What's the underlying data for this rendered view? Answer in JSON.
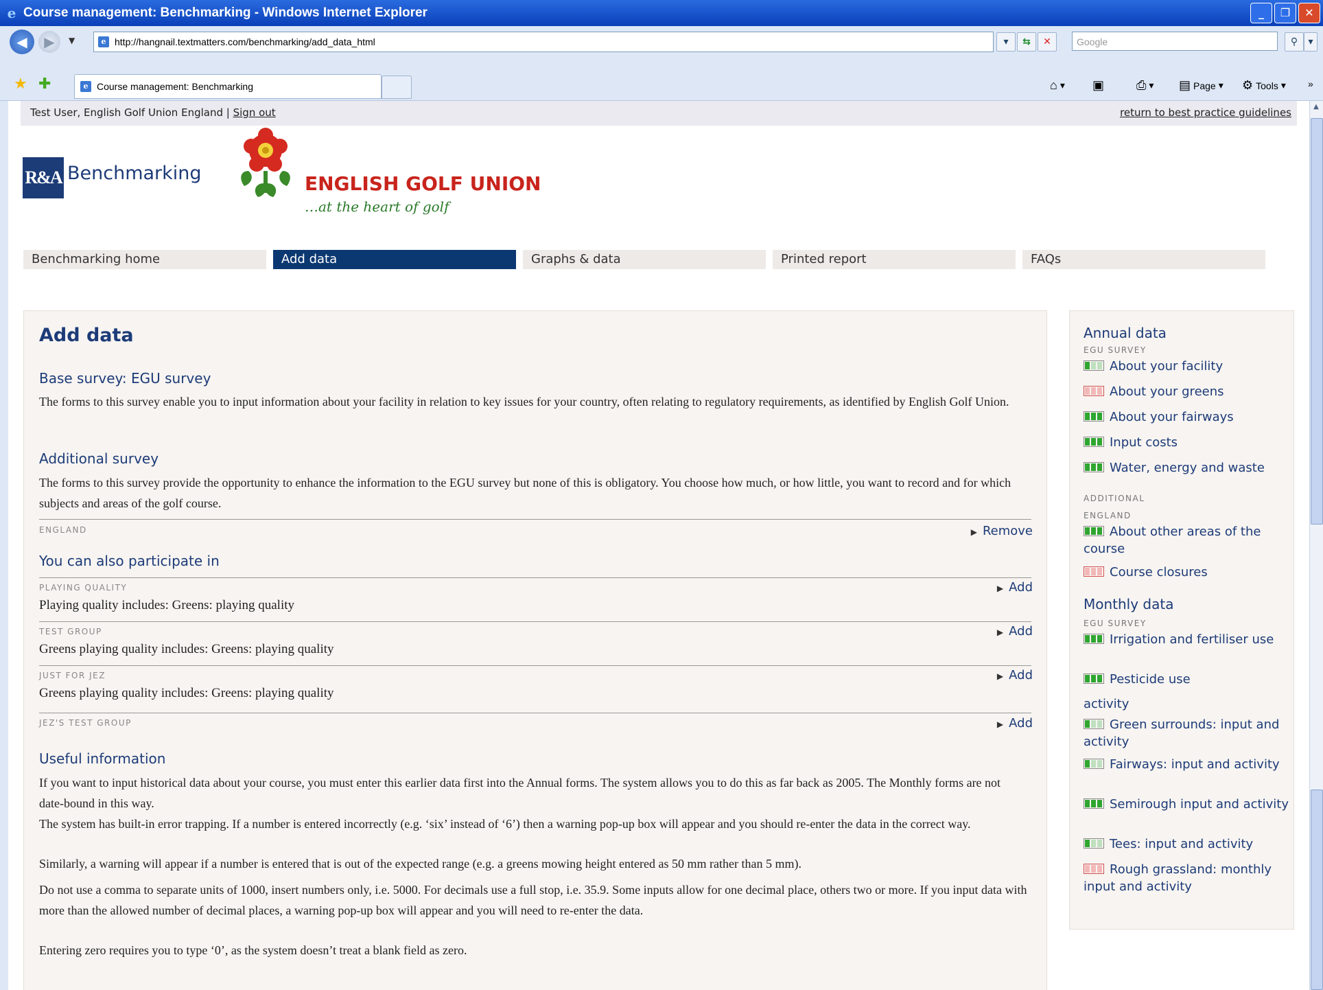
{
  "window": {
    "title": "Course management: Benchmarking - Windows Internet Explorer",
    "url": "http://hangnail.textmatters.com/benchmarking/add_data_html",
    "search_placeholder": "Google",
    "tab_title": "Course management: Benchmarking",
    "commands": {
      "page": "Page",
      "tools": "Tools"
    }
  },
  "userbar": {
    "user": "Test User, English Golf Union England",
    "separator": "|",
    "signout": "Sign out",
    "return_link": "return to best practice guidelines"
  },
  "brand": {
    "ra_logo": "R&A",
    "ra_text": "Benchmarking",
    "egu_name": "ENGLISH GOLF UNION",
    "egu_tagline": "…at the heart of golf"
  },
  "nav": [
    {
      "label": "Benchmarking home",
      "active": false
    },
    {
      "label": "Add data",
      "active": true
    },
    {
      "label": "Graphs & data",
      "active": false
    },
    {
      "label": "Printed report",
      "active": false
    },
    {
      "label": "FAQs",
      "active": false
    }
  ],
  "main": {
    "title": "Add data",
    "base_heading": "Base survey: EGU survey",
    "base_text": "The forms to this survey enable you to input information about your facility in relation to key issues for your country, often relating to regulatory requirements, as identified by English Golf Union.",
    "additional_heading": "Additional survey",
    "additional_text": "The forms to this survey provide the opportunity to enhance the information to the EGU survey but none of this is obligatory. You choose how much, or how little, you want to record and for which subjects and areas of the golf course.",
    "england_label": "ENGLAND",
    "remove_label": "Remove",
    "participate_heading": "You can also participate in",
    "groups": [
      {
        "label": "PLAYING QUALITY",
        "text": "Playing quality includes: Greens: playing quality",
        "action": "Add"
      },
      {
        "label": "TEST GROUP",
        "text": "Greens playing quality includes: Greens: playing quality",
        "action": "Add"
      },
      {
        "label": "JUST FOR JEZ",
        "text": "Greens playing quality includes: Greens: playing quality",
        "action": "Add"
      },
      {
        "label": "JEZ'S TEST GROUP",
        "text": "",
        "action": "Add"
      }
    ],
    "useful_heading": "Useful information",
    "useful_paras": [
      "If you want to input historical data about your course, you must enter this earlier data first into the Annual forms. The system allows you to do this as far back as 2005. The Monthly forms are not date-bound in this way.",
      "The system has built-in error trapping. If a number is entered incorrectly (e.g. ‘six’ instead of ‘6’) then a warning pop-up box will appear and you should re-enter the data in the correct way.",
      "Similarly, a warning will appear if a number is entered that is out of the expected range (e.g. a greens mowing height entered as 50 mm rather than 5 mm).",
      "Do not use a comma to separate units of 1000, insert numbers only, i.e. 5000. For decimals use a full stop, i.e. 35.9. Some inputs allow for one decimal place, others two or more. If you input data with more than the allowed number of decimal places, a warning pop-up box will appear and you will need to re-enter the data.",
      "Entering zero requires you to type ‘0’, as the system doesn’t treat a blank field as zero."
    ]
  },
  "sidebar": {
    "annual_heading": "Annual data",
    "annual_cat": "EGU SURVEY",
    "annual_items": [
      {
        "label": "About your facility",
        "status": "part"
      },
      {
        "label": "About your greens",
        "status": "none"
      },
      {
        "label": "About your fairways",
        "status": "full"
      },
      {
        "label": "Input costs",
        "status": "full"
      },
      {
        "label": "Water, energy and waste",
        "status": "full"
      }
    ],
    "additional_cat": "ADDITIONAL",
    "england_cat": "ENGLAND",
    "additional_items": [
      {
        "label": "About other areas of the course",
        "status": "full"
      },
      {
        "label": "Course closures",
        "status": "none"
      }
    ],
    "monthly_heading": "Monthly data",
    "monthly_cat": "EGU SURVEY",
    "monthly_items": [
      {
        "label": "Irrigation and fertiliser use",
        "status": "full"
      },
      {
        "label": "Pesticide use",
        "status": "full"
      }
    ],
    "cutoff_text": "activity",
    "more_items": [
      {
        "label": "Green surrounds: input and activity",
        "status": "part"
      },
      {
        "label": "Fairways: input and activity",
        "status": "part"
      },
      {
        "label": "Semirough input and activity",
        "status": "full"
      },
      {
        "label": "Tees: input and activity",
        "status": "part"
      },
      {
        "label": "Rough grassland: monthly input and activity",
        "status": "none"
      }
    ]
  }
}
